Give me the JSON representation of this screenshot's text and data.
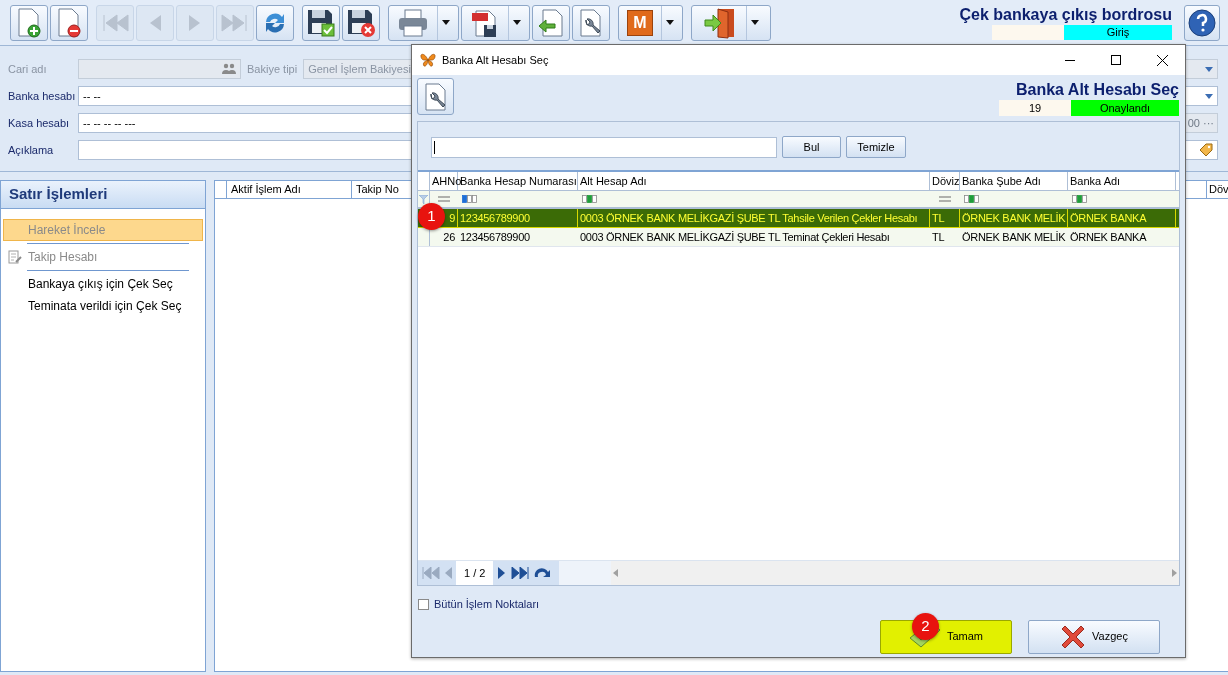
{
  "toolbar": {
    "groups": [
      {
        "buttons": [
          {
            "kind": "new",
            "disabled": false,
            "dropdown": false
          },
          {
            "kind": "delete",
            "disabled": false,
            "dropdown": false
          }
        ]
      },
      {
        "buttons": [
          {
            "kind": "first",
            "disabled": true,
            "dropdown": false
          },
          {
            "kind": "prev",
            "disabled": true,
            "dropdown": false
          },
          {
            "kind": "next",
            "disabled": true,
            "dropdown": false
          },
          {
            "kind": "last",
            "disabled": true,
            "dropdown": false
          },
          {
            "kind": "refresh",
            "disabled": false,
            "dropdown": false
          }
        ]
      },
      {
        "buttons": [
          {
            "kind": "save",
            "disabled": false,
            "dropdown": false
          },
          {
            "kind": "discard",
            "disabled": false,
            "dropdown": false
          }
        ]
      },
      {
        "buttons": [
          {
            "kind": "print",
            "disabled": false,
            "dropdown": true
          },
          {
            "kind": "pdf",
            "disabled": false,
            "dropdown": true
          },
          {
            "kind": "import",
            "disabled": false,
            "dropdown": false
          },
          {
            "kind": "settings",
            "disabled": false,
            "dropdown": false
          }
        ]
      },
      {
        "buttons": [
          {
            "kind": "letter",
            "label": "M",
            "disabled": false,
            "dropdown": true
          }
        ]
      },
      {
        "buttons": [
          {
            "kind": "exit",
            "disabled": false,
            "dropdown": true
          }
        ]
      }
    ]
  },
  "header": {
    "title": "Çek bankaya çıkış bordrosu",
    "mode": "Giriş"
  },
  "form": {
    "cari": {
      "label": "Cari adı",
      "disabled": true
    },
    "bakiye": {
      "label": "Bakiye tipi",
      "value": "Genel İşlem Bakiyesi",
      "disabled": true
    },
    "banka": {
      "label": "Banka hesabı",
      "value": "-- --"
    },
    "kasa": {
      "label": "Kasa hesabı",
      "value": "-- -- -- -- ---"
    },
    "amount": {
      "value": "00",
      "button": "···",
      "disabled": true
    },
    "aciklama": {
      "label": "Açıklama"
    }
  },
  "sidebar": {
    "title": "Satır İşlemleri",
    "items": [
      {
        "label": "Hareket İncele",
        "selected": true,
        "disabled": true,
        "icon": false
      },
      {
        "label": "Takip Hesabı",
        "selected": false,
        "disabled": true,
        "icon": true
      },
      {
        "label": "Bankaya çıkış için Çek Seç",
        "selected": false,
        "disabled": false,
        "icon": false
      },
      {
        "label": "Teminata verildi için Çek Seç",
        "selected": false,
        "disabled": false,
        "icon": false
      }
    ]
  },
  "grid": {
    "columns": [
      "Aktif İşlem Adı",
      "Takip No",
      "Döv"
    ]
  },
  "dialog": {
    "title": "Banka Alt Hesabı Seç",
    "header_title": "Banka Alt Hesabı Seç",
    "record_no": "19",
    "status": "Onaylandı",
    "search_buttons": [
      "Bul",
      "Temizle"
    ],
    "table": {
      "columns": [
        "AHNo",
        "Banka Hesap Numarası",
        "Alt Hesap Adı",
        "Döviz",
        "Banka Şube Adı",
        "Banka Adı"
      ],
      "filters": [
        {
          "kind": "equals"
        },
        {
          "kind": "starts_with"
        },
        {
          "kind": "contains"
        },
        {
          "kind": "equals"
        },
        {
          "kind": "contains"
        },
        {
          "kind": "contains"
        }
      ],
      "rows": [
        {
          "selected": true,
          "cells": [
            "9",
            "123456789900",
            "0003 ÖRNEK BANK MELİKGAZİ ŞUBE TL Tahsile Verilen Çekler Hesabı",
            "TL",
            "ÖRNEK BANK MELİK",
            "ÖRNEK BANKA"
          ]
        },
        {
          "selected": false,
          "cells": [
            "26",
            "123456789900",
            "0003 ÖRNEK BANK MELİKGAZİ ŞUBE TL Teminat Çekleri Hesabı",
            "TL",
            "ÖRNEK BANK MELİK",
            "ÖRNEK BANKA"
          ]
        }
      ]
    },
    "pager": "1 / 2",
    "all_points": {
      "label": "Bütün İşlem Noktaları",
      "checked": false
    },
    "ok": {
      "label": "Tamam",
      "highlighted": true
    },
    "cancel": {
      "label": "Vazgeç",
      "highlighted": false
    },
    "callouts": [
      "1",
      "2"
    ]
  }
}
